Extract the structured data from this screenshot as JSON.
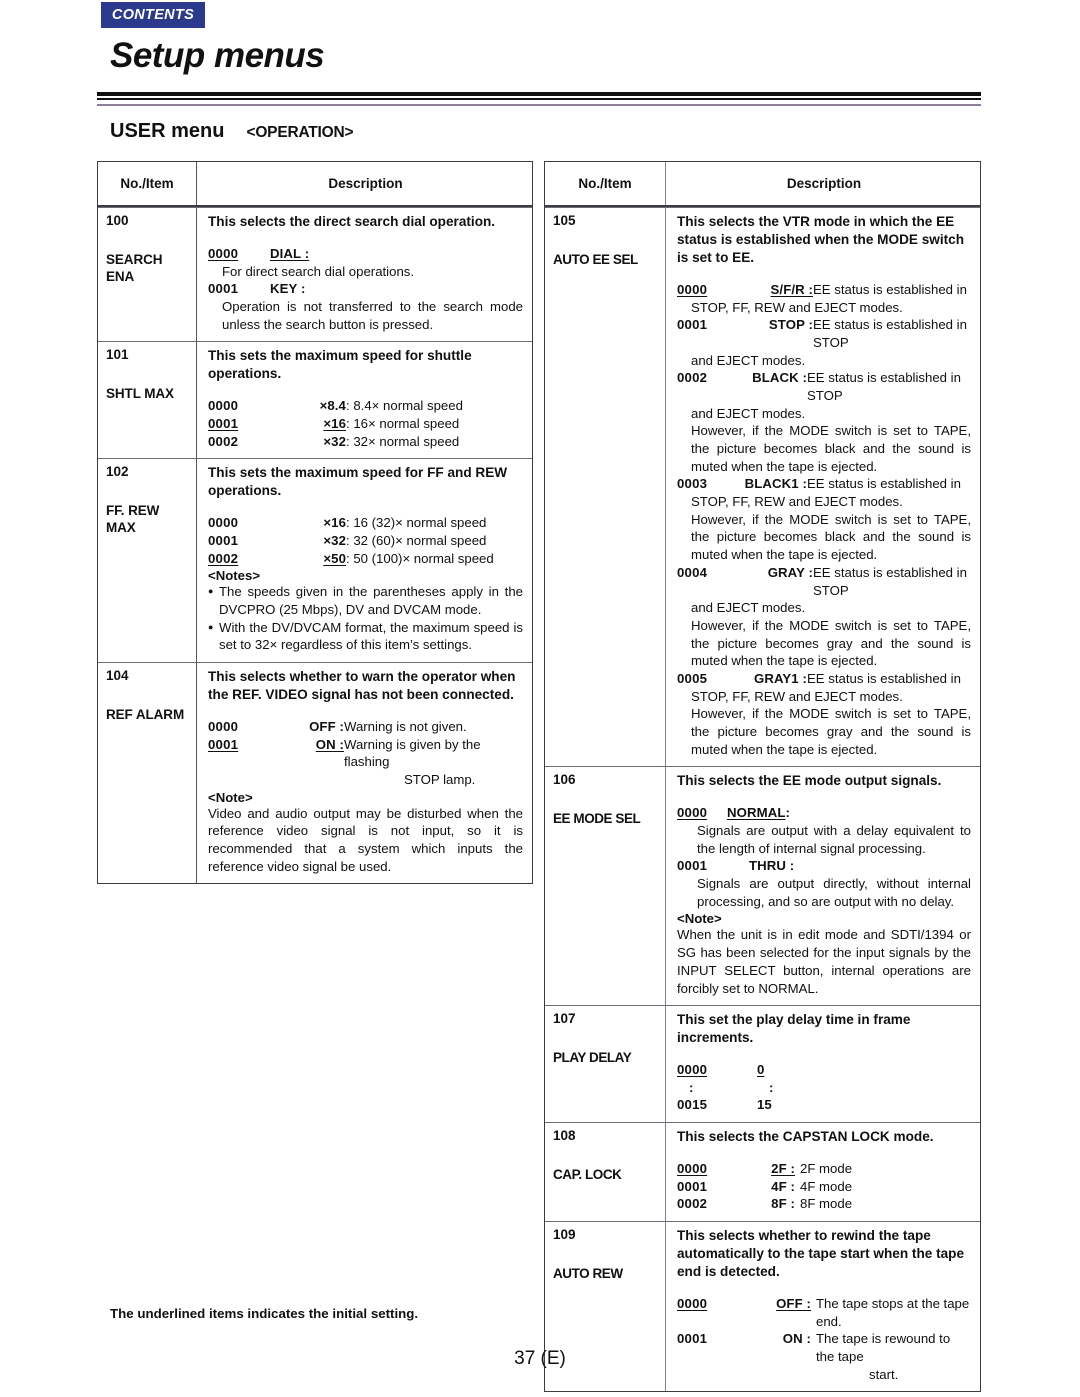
{
  "header": {
    "contents_badge": "CONTENTS",
    "title": "Setup menus",
    "section_title": "USER menu",
    "section_sub": "<OPERATION>"
  },
  "columns": {
    "no_item": "No./Item",
    "description": "Description"
  },
  "left_table": {
    "rows": [
      {
        "no": "100",
        "item": "SEARCH ENA",
        "desc_head": "This selects the direct search dial operation.",
        "opt1_code": "0000",
        "opt1_label": "DIAL :",
        "opt1_text": "For direct search dial operations.",
        "opt2_code": "0001",
        "opt2_label": "KEY :",
        "opt2_text": "Operation is not transferred to the search mode unless the search button is pressed."
      },
      {
        "no": "101",
        "item": "SHTL MAX",
        "desc_head": "This sets the maximum speed for shuttle operations.",
        "o": [
          {
            "code": "0000",
            "sym": "×8.4",
            "text": ": 8.4× normal speed"
          },
          {
            "code": "0001",
            "sym": "×16",
            "text": ": 16× normal speed"
          },
          {
            "code": "0002",
            "sym": "×32",
            "text": ": 32× normal speed"
          }
        ]
      },
      {
        "no": "102",
        "item": "FF. REW MAX",
        "desc_head": "This sets the maximum speed for FF and REW operations.",
        "o": [
          {
            "code": "0000",
            "sym": "×16",
            "text": ": 16 (32)× normal speed"
          },
          {
            "code": "0001",
            "sym": "×32",
            "text": ": 32 (60)× normal speed"
          },
          {
            "code": "0002",
            "sym": "×50",
            "text": ": 50 (100)× normal speed"
          }
        ],
        "notes_hd": "<Notes>",
        "note1": "The speeds given in the parentheses apply in the DVCPRO (25 Mbps), DV and DVCAM mode.",
        "note2": "With the DV/DVCAM format, the maximum speed is set to 32× regardless of this item’s settings."
      },
      {
        "no": "104",
        "item": "REF ALARM",
        "desc_head": "This selects whether to warn the operator when the REF. VIDEO signal has not been connected.",
        "opt1_code": "0000",
        "opt1_label": "OFF :",
        "opt1_text": "Warning is not given.",
        "opt2_code": "0001",
        "opt2_label": "ON :",
        "opt2_text": "Warning is given by the flashing",
        "opt2_text2": "STOP lamp.",
        "note_hd": "<Note>",
        "note": "Video and audio output may be disturbed when the reference video signal is not input, so it is recommended that a system which inputs the reference video signal be used."
      }
    ]
  },
  "right_table": {
    "rows": [
      {
        "no": "105",
        "item": "AUTO EE SEL",
        "desc_head": "This selects the VTR mode in which the EE status is established when the MODE switch is set to EE.",
        "o": [
          {
            "code": "0000",
            "label": "S/F/R :",
            "u": true,
            "text": "EE status is established in",
            "cont": "STOP, FF, REW and EJECT modes."
          },
          {
            "code": "0001",
            "label": "STOP :",
            "u": false,
            "text": "EE status is established in STOP",
            "cont": "and EJECT modes."
          },
          {
            "code": "0002",
            "label": "BLACK :",
            "u": false,
            "text": "EE status is established in STOP",
            "cont": "and EJECT modes.",
            "cont2": "However, if the MODE switch is set to TAPE, the picture becomes black and the sound is muted when the tape is ejected."
          },
          {
            "code": "0003",
            "label": "BLACK1 :",
            "u": false,
            "text": "EE status is established in",
            "cont": "STOP, FF, REW and EJECT modes.",
            "cont2": "However, if the MODE switch is set to TAPE, the picture becomes black and the sound is muted when the tape is ejected."
          },
          {
            "code": "0004",
            "label": "GRAY :",
            "u": false,
            "text": "EE status is established in STOP",
            "cont": "and EJECT modes.",
            "cont2": "However, if the MODE switch is set to TAPE, the picture becomes gray and the sound is muted when the tape is ejected."
          },
          {
            "code": "0005",
            "label": "GRAY1 :",
            "u": false,
            "text": "EE status is established in",
            "cont": "STOP, FF, REW and EJECT modes.",
            "cont2": "However, if the MODE switch is set to TAPE, the picture becomes gray and the sound is muted when the tape is ejected."
          }
        ]
      },
      {
        "no": "106",
        "item": "EE MODE SEL",
        "desc_head": "This selects the EE mode output signals.",
        "opt1_code": "0000",
        "opt1_label": "NORMAL",
        "opt1_colon": ":",
        "opt1_text": "Signals are output with a delay equivalent to the length of internal signal processing.",
        "opt2_code": "0001",
        "opt2_label": "THRU :",
        "opt2_text": "Signals are output directly, without internal processing, and so are output with no delay.",
        "note_hd": "<Note>",
        "note": "When the unit is in edit mode and SDTI/1394 or SG has been selected for the input signals by the INPUT SELECT button, internal operations are forcibly set to NORMAL."
      },
      {
        "no": "107",
        "item": "PLAY DELAY",
        "desc_head": "This set the play delay time in frame increments.",
        "o": [
          {
            "code": "0000",
            "val": "0",
            "u": true
          },
          {
            "code": ":",
            "val": ":",
            "u": false
          },
          {
            "code": "0015",
            "val": "15",
            "u": false
          }
        ]
      },
      {
        "no": "108",
        "item": "CAP. LOCK",
        "desc_head": "This selects the CAPSTAN LOCK mode.",
        "o": [
          {
            "code": "0000",
            "label": "2F :",
            "text": "2F mode",
            "u": true
          },
          {
            "code": "0001",
            "label": "4F :",
            "text": "4F mode",
            "u": false
          },
          {
            "code": "0002",
            "label": "8F :",
            "text": "8F mode",
            "u": false
          }
        ]
      },
      {
        "no": "109",
        "item": "AUTO REW",
        "desc_head": "This selects whether to rewind the tape automatically to the tape start when the tape end is detected.",
        "opt1_code": "0000",
        "opt1_label": "OFF :",
        "opt1_text": "The tape stops at the tape end.",
        "opt2_code": "0001",
        "opt2_label": "ON :",
        "opt2_text": "The tape is rewound to the tape",
        "opt2_text2": "start."
      }
    ]
  },
  "footer": {
    "footnote": "The underlined items indicates the initial setting.",
    "page_number": "37 (E)"
  }
}
